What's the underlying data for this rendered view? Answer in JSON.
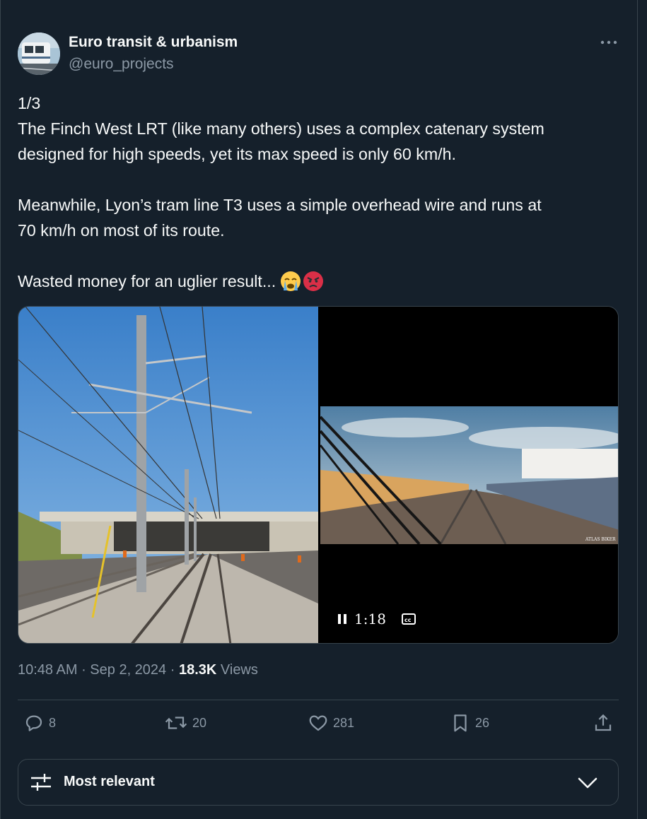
{
  "author": {
    "name": "Euro transit & urbanism",
    "handle": "@euro_projects"
  },
  "tweet": {
    "lines": [
      "1/3",
      "The Finch West LRT (like many others) uses a complex catenary system",
      "designed for high speeds, yet its max speed is only 60 km/h.",
      "",
      "Meanwhile, Lyon’s tram line T3 uses a simple overhead wire and runs at",
      "70 km/h on most of its route.",
      "",
      "Wasted money for an uglier result..."
    ],
    "emojis": [
      "crying-face-emoji",
      "angry-face-emoji"
    ]
  },
  "media": {
    "video": {
      "time": "1:18",
      "watermark": "ATLAS BIKER",
      "play_state": "playing"
    }
  },
  "meta": {
    "time": "10:48 AM",
    "date": "Sep 2, 2024",
    "views_count": "18.3K",
    "views_label": "Views"
  },
  "actions": {
    "replies": "8",
    "reposts": "20",
    "likes": "281",
    "bookmarks": "26"
  },
  "sort": {
    "label": "Most relevant"
  },
  "colors": {
    "background": "#15202b",
    "text": "#f7f9f9",
    "secondary": "#8b98a5",
    "border": "#38444d"
  }
}
